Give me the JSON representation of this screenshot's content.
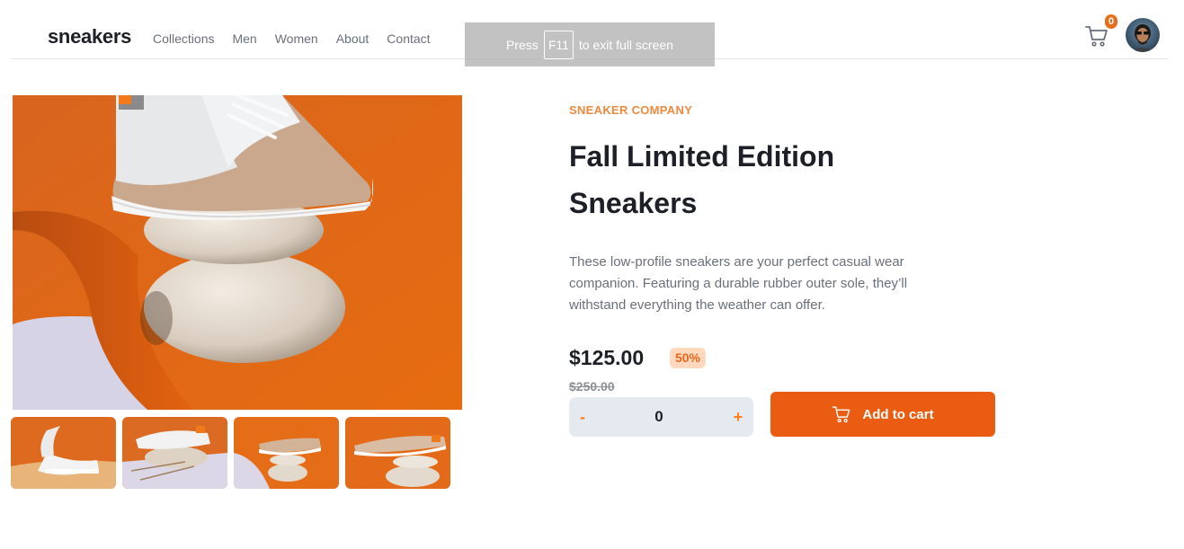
{
  "header": {
    "logo": "sneakers",
    "nav": [
      "Collections",
      "Men",
      "Women",
      "About",
      "Contact"
    ],
    "cart_icon": "cart-icon",
    "cart_count": "0",
    "avatar": "user-avatar"
  },
  "fullscreen_notice": {
    "before": "Press",
    "key": "F11",
    "after": "to exit full screen"
  },
  "gallery": {
    "main_image": "product-photo-sneaker-on-stones",
    "thumbnails": [
      "thumbnail-1",
      "thumbnail-2",
      "thumbnail-3",
      "thumbnail-4"
    ]
  },
  "product": {
    "company": "SNEAKER COMPANY",
    "title_line1": "Fall Limited Edition",
    "title_line2": "Sneakers",
    "description": "These low-profile sneakers are your perfect casual wear companion. Featuring a durable rubber outer sole, they’ll withstand everything the weather can offer.",
    "price": "$125.00",
    "discount": "50%",
    "old_price": "$250.00",
    "quantity": "0",
    "minus_label": "-",
    "plus_label": "+",
    "add_to_cart_label": "Add to cart"
  },
  "colors": {
    "accent": "#ea5c11",
    "accent_light": "#ffd8bd",
    "text_dark": "#1d2026",
    "text_muted": "#69707d",
    "qty_bg": "#e5eaf1"
  }
}
